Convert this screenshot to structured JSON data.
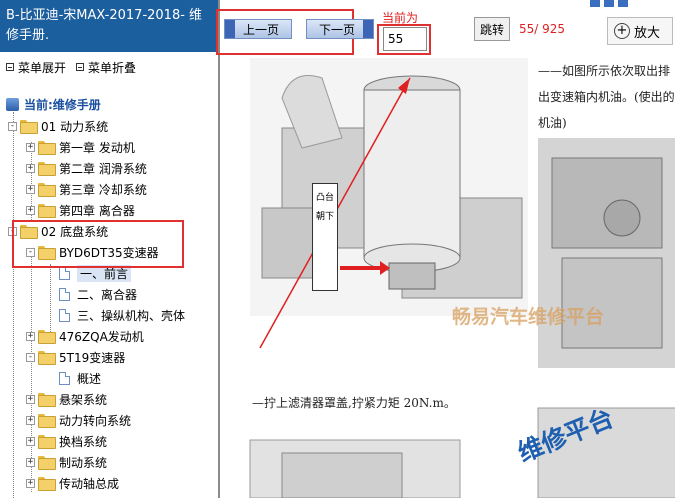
{
  "sidebar": {
    "title": "B-比亚迪-宋MAX-2017-2018- 维修手册.",
    "expand_label": "菜单展开",
    "collapse_label": "菜单折叠",
    "current_label": "当前:维修手册",
    "tree": [
      {
        "label": "01 动力系统"
      },
      {
        "label": "第一章 发动机"
      },
      {
        "label": "第二章 润滑系统"
      },
      {
        "label": "第三章 冷却系统"
      },
      {
        "label": "第四章 离合器"
      },
      {
        "label": "02 底盘系统"
      },
      {
        "label": "BYD6DT35变速器"
      },
      {
        "label": "一、前言"
      },
      {
        "label": "二、离合器"
      },
      {
        "label": "三、操纵机构、壳体"
      },
      {
        "label": "476ZQA发动机"
      },
      {
        "label": "5T19变速器"
      },
      {
        "label": "概述"
      },
      {
        "label": "悬架系统"
      },
      {
        "label": "动力转向系统"
      },
      {
        "label": "换档系统"
      },
      {
        "label": "制动系统"
      },
      {
        "label": "传动轴总成"
      }
    ]
  },
  "toolbar": {
    "prev_label": "上一页",
    "next_label": "下一页",
    "current_page_label": "当前为",
    "page_value": "55",
    "jump_label": "跳转",
    "page_count": "55/ 925",
    "zoom_label": "放大"
  },
  "content": {
    "side_text": "——如图所示依次取出排出变速箱内机油。(使出的机油)",
    "caption": "—拧上滤清器罩盖,拧紧力矩 20N.m。",
    "vertical_label": "凸台朝下",
    "watermark_1": "畅易汽车维修平台",
    "watermark_2": "维修平台"
  },
  "colors": {
    "title_bg": "#1c5f9e",
    "highlight_red": "#e03030",
    "folder": "#f4d06b"
  }
}
